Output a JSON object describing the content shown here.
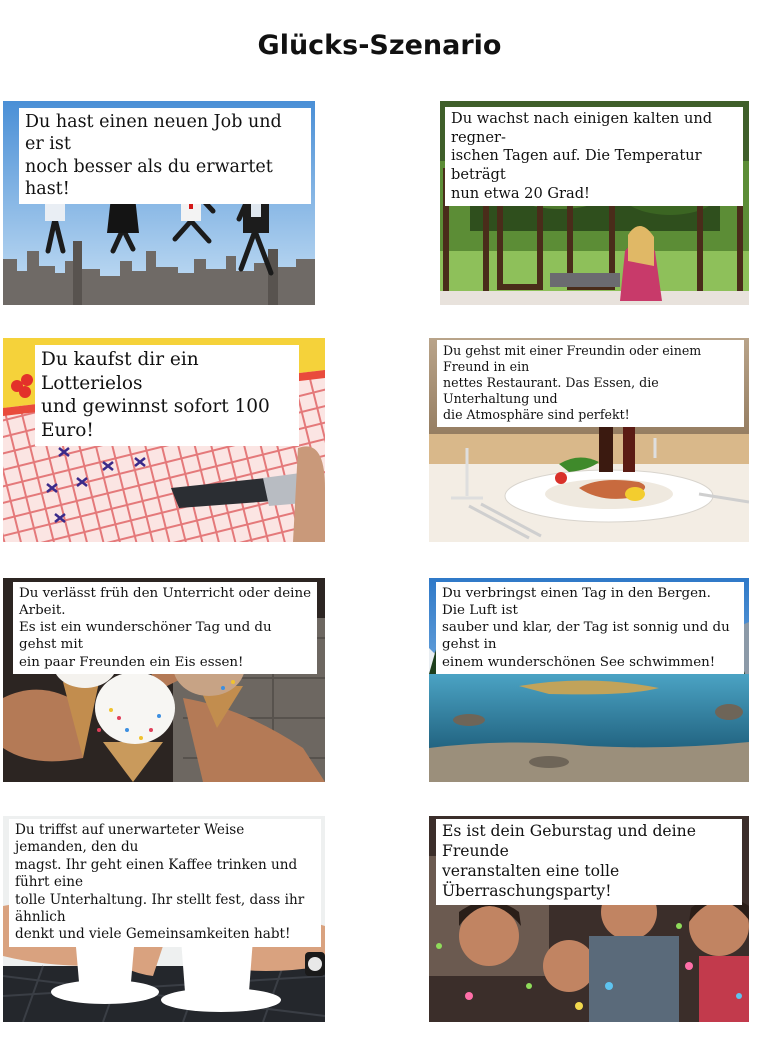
{
  "page": {
    "title": "Glücks-Szenario"
  },
  "scenarios": [
    {
      "id": "job",
      "image": "people-jumping-over-city-skyline",
      "text": "Du hast einen neuen Job und er ist\nnoch besser als du erwartet hast!"
    },
    {
      "id": "weather",
      "image": "woman-at-open-windows-garden",
      "text": "Du wachst nach einigen kalten und regner-\nischen Tagen auf. Die Temperatur beträgt\nnun etwa 20 Grad!"
    },
    {
      "id": "lottery",
      "image": "lottery-ticket-and-pen",
      "text": "Du kaufst dir ein Lotterielos\nund gewinnst sofort 100 Euro!"
    },
    {
      "id": "restaurant",
      "image": "restaurant-plate-and-wine-glasses",
      "text": "Du gehst mit einer Freundin oder einem Freund in ein\nnettes Restaurant. Das Essen, die Unterhaltung und\ndie Atmosphäre sind perfekt!"
    },
    {
      "id": "icecream",
      "image": "ice-cream-cones-with-sprinkles",
      "text": "Du verlässt früh den Unterricht oder deine Arbeit.\nEs ist ein wunderschöner Tag und du gehst mit\nein paar Freunden ein Eis essen!"
    },
    {
      "id": "mountains",
      "image": "mountain-lake-landscape",
      "text": "Du verbringst einen Tag in den Bergen. Die Luft ist\nsauber und klar, der Tag ist sonnig und du gehst in\neinem wunderschönen See schwimmen!"
    },
    {
      "id": "coffee",
      "image": "two-cappuccino-cups-with-hearts",
      "text": "Du triffst auf unerwarteter Weise jemanden, den du\nmagst. Ihr geht einen Kaffee trinken und führt eine\ntolle Unterhaltung. Ihr stellt fest, dass ihr ähnlich\ndenkt und viele Gemeinsamkeiten habt!"
    },
    {
      "id": "birthday",
      "image": "surprise-party-confetti",
      "text": "Es ist dein Geburstag und deine Freunde\nveranstalten eine tolle Überraschungsparty!"
    }
  ]
}
